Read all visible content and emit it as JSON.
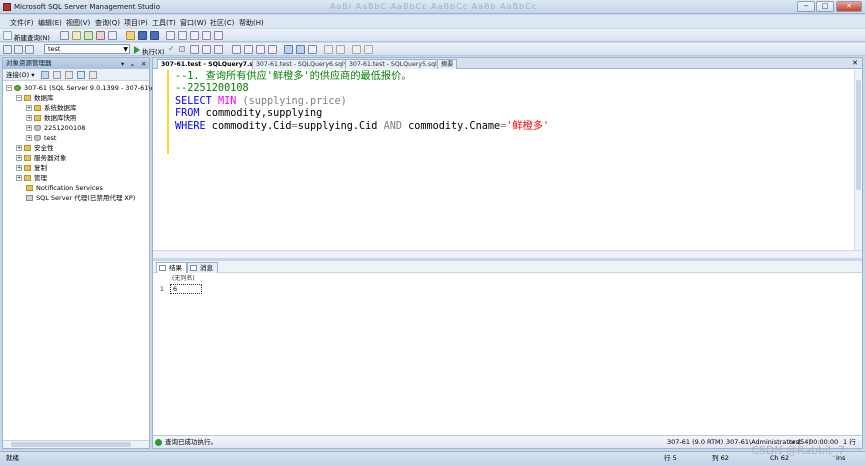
{
  "window": {
    "title": "Microsoft SQL Server Management Studio",
    "ribbon_ghost": "AaBl  AaBbC  AaBbCc  AaBbCc  AaBb  AaBbCc"
  },
  "menu": [
    "文件(F)",
    "编辑(E)",
    "视图(V)",
    "查询(Q)",
    "项目(P)",
    "工具(T)",
    "窗口(W)",
    "社区(C)",
    "帮助(H)"
  ],
  "toolbar": {
    "new_query": "新建查询(N)",
    "database": "test",
    "execute": "执行(X)"
  },
  "object_explorer": {
    "title": "对象资源管理器",
    "connect": "连接(O) ▾",
    "nodes": [
      {
        "label": "307-61 (SQL Server 9.0.1399 - 307-61\\en",
        "level": 0,
        "icon": "server",
        "expander": "−"
      },
      {
        "label": "数据库",
        "level": 1,
        "icon": "folder",
        "expander": "−"
      },
      {
        "label": "系统数据库",
        "level": 2,
        "icon": "folder",
        "expander": "+"
      },
      {
        "label": "数据库快照",
        "level": 2,
        "icon": "folder",
        "expander": "+"
      },
      {
        "label": "2251200108",
        "level": 2,
        "icon": "db",
        "expander": "+"
      },
      {
        "label": "test",
        "level": 2,
        "icon": "db",
        "expander": "+"
      },
      {
        "label": "安全性",
        "level": 1,
        "icon": "folder",
        "expander": "+"
      },
      {
        "label": "服务器对象",
        "level": 1,
        "icon": "folder",
        "expander": "+"
      },
      {
        "label": "复制",
        "level": 1,
        "icon": "folder",
        "expander": "+"
      },
      {
        "label": "管理",
        "level": 1,
        "icon": "folder",
        "expander": "+"
      },
      {
        "label": "Notification Services",
        "level": 1,
        "icon": "folder",
        "expander": ""
      },
      {
        "label": "SQL Server 代理(已禁用代理 XP)",
        "level": 1,
        "icon": "agent",
        "expander": ""
      }
    ]
  },
  "tabs": [
    {
      "label": "307-61.test - SQLQuery7.sql*",
      "active": true
    },
    {
      "label": "307-61.test - SQLQuery6.sql*",
      "active": false
    },
    {
      "label": "307-61.test - SQLQuery5.sql*",
      "active": false
    },
    {
      "label": "摘要",
      "active": false
    }
  ],
  "editor": {
    "line1": "--1. 查询所有供应'鲜橙多'的供应商的最低报价。",
    "line2": "--2251200108",
    "line3": {
      "kw": "SELECT",
      "fn": "MIN",
      "rest": " (supplying.price)"
    },
    "line4": {
      "kw": "FROM",
      "rest": " commodity,supplying"
    },
    "line5": {
      "kw": "WHERE",
      "a": " commodity.Cid",
      "eq": "=",
      "b": "supplying.Cid ",
      "and": "AND",
      "c": " commodity.Cname",
      "eq2": "=",
      "str": "'鲜橙多'"
    }
  },
  "results": {
    "tab_results": "结果",
    "tab_messages": "消息",
    "column_header": "(无列名)",
    "row_number": "1",
    "value": "6"
  },
  "query_status": {
    "message": "查询已成功执行。",
    "server": "307-61 (9.0 RTM)",
    "user": "307-61\\Administrator (54)",
    "db": "test",
    "time": "00:00:00",
    "rows": "1 行"
  },
  "statusbar": {
    "ready": "就绪",
    "line": "行 5",
    "col": "列 62",
    "ch": "Ch 62",
    "ins": "Ins"
  },
  "watermark": "CSDN @Rabbit_7"
}
